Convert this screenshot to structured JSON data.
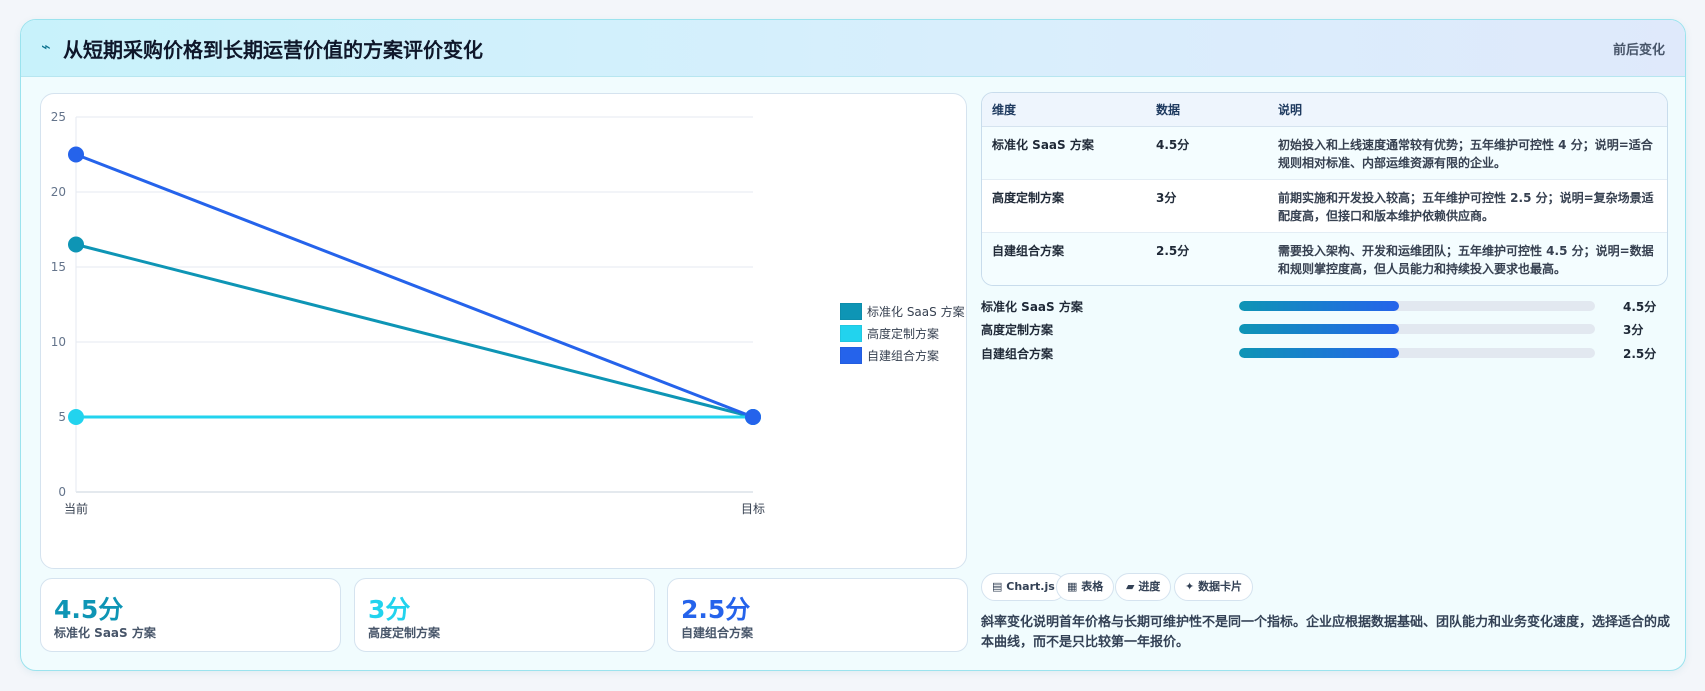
{
  "header": {
    "icon": "sparkline-icon",
    "title_icon_glyph": "⌁",
    "title": "从短期采购价格到长期运营价值的方案评价变化",
    "right_label": "前后变化"
  },
  "colors": {
    "teal": "#0e95b5",
    "cyan": "#22d3ee",
    "blue": "#2563eb"
  },
  "chart_data": {
    "type": "line",
    "categories": [
      "当前",
      "目标"
    ],
    "series": [
      {
        "name": "标准化 SaaS 方案",
        "values": [
          16.5,
          5
        ],
        "color": "#0e95b5"
      },
      {
        "name": "高度定制方案",
        "values": [
          5,
          5
        ],
        "color": "#22d3ee"
      },
      {
        "name": "自建组合方案",
        "values": [
          22.5,
          5
        ],
        "color": "#2563eb"
      }
    ],
    "ylim": [
      0,
      25
    ],
    "yticks": [
      0,
      5,
      10,
      15,
      20,
      25
    ],
    "grid": true,
    "legend_position": "right"
  },
  "kpis": [
    {
      "value": "4.5分",
      "label": "标准化 SaaS 方案",
      "color": "#0e95b5"
    },
    {
      "value": "3分",
      "label": "高度定制方案",
      "color": "#22d3ee"
    },
    {
      "value": "2.5分",
      "label": "自建组合方案",
      "color": "#2563eb"
    }
  ],
  "table": {
    "headers": [
      "维度",
      "数据",
      "说明"
    ],
    "rows": [
      {
        "name": "标准化 SaaS 方案",
        "value": "4.5分",
        "desc": "初始投入和上线速度通常较有优势；五年维护可控性 4 分；说明=适合规则相对标准、内部运维资源有限的企业。"
      },
      {
        "name": "高度定制方案",
        "value": "3分",
        "desc": "前期实施和开发投入较高；五年维护可控性 2.5 分；说明=复杂场景适配度高，但接口和版本维护依赖供应商。"
      },
      {
        "name": "自建组合方案",
        "value": "2.5分",
        "desc": "需要投入架构、开发和运维团队；五年维护可控性 4.5 分；说明=数据和规则掌控度高，但人员能力和持续投入要求也最高。"
      }
    ]
  },
  "progress": [
    {
      "label": "标准化 SaaS 方案",
      "value": "4.5分",
      "fraction": 0.45
    },
    {
      "label": "高度定制方案",
      "value": "3分",
      "fraction": 0.45
    },
    {
      "label": "自建组合方案",
      "value": "2.5分",
      "fraction": 0.45
    }
  ],
  "chips": [
    {
      "icon": "chart-icon",
      "glyph": "▤",
      "label": "Chart.js"
    },
    {
      "icon": "table-icon",
      "glyph": "▦",
      "label": "表格"
    },
    {
      "icon": "progress-icon",
      "glyph": "▰",
      "label": "进度"
    },
    {
      "icon": "sparkle-icon",
      "glyph": "✦",
      "label": "数据卡片"
    }
  ],
  "note": "斜率变化说明首年价格与长期可维护性不是同一个指标。企业应根据数据基础、团队能力和业务变化速度，选择适合的成本曲线，而不是只比较第一年报价。"
}
